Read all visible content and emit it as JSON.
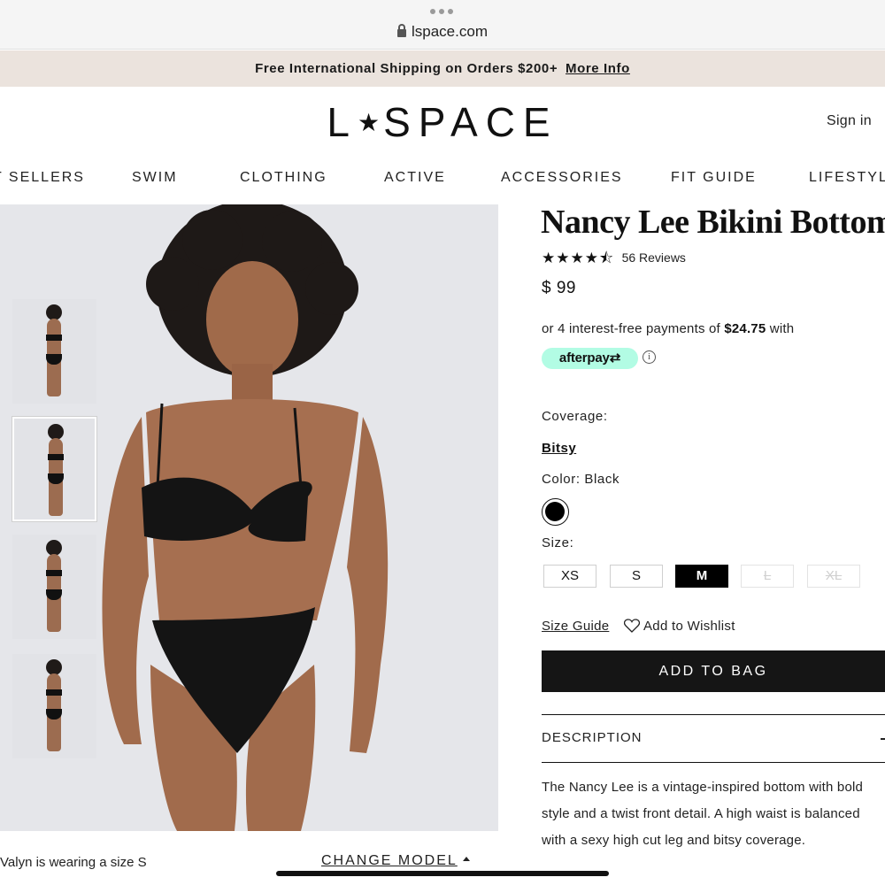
{
  "browser": {
    "url": "lspace.com"
  },
  "promo": {
    "text": "Free International Shipping on Orders $200+",
    "link": "More Info"
  },
  "header": {
    "logo_left": "L",
    "logo_right": "SPACE",
    "sign_in": "Sign in"
  },
  "nav": {
    "items": [
      "T SELLERS",
      "SWIM",
      "CLOTHING",
      "ACTIVE",
      "ACCESSORIES",
      "FIT GUIDE",
      "LIFESTYLE"
    ]
  },
  "gallery": {
    "caption": "Valyn is wearing a size S",
    "change_model": "CHANGE MODEL",
    "thumbnail_count": 4,
    "active_thumbnail": 2
  },
  "product": {
    "title": "Nancy Lee Bikini Bottom",
    "rating": 4.5,
    "reviews": "56 Reviews",
    "price": "$ 99",
    "installments_prefix": "or 4 interest-free payments of",
    "installments_amount": "$24.75",
    "installments_suffix": "with",
    "afterpay_label": "afterpay",
    "coverage_label": "Coverage:",
    "coverage_value": "Bitsy",
    "color_label": "Color: Black",
    "swatch_color": "#000000",
    "size_label": "Size:",
    "sizes": [
      "XS",
      "S",
      "M",
      "L",
      "XL"
    ],
    "selected_size": "M",
    "size_guide": "Size Guide",
    "wishlist": "Add to Wishlist",
    "add_to_bag": "ADD TO BAG",
    "description_heading": "DESCRIPTION",
    "description": "The Nancy Lee is a vintage-inspired bottom with bold style and a twist front detail. A high waist is balanced with a sexy high cut leg and bitsy coverage."
  },
  "colors": {
    "promo_bg": "#ebe3dd",
    "afterpay": "#b2fce4",
    "button": "#151515"
  }
}
